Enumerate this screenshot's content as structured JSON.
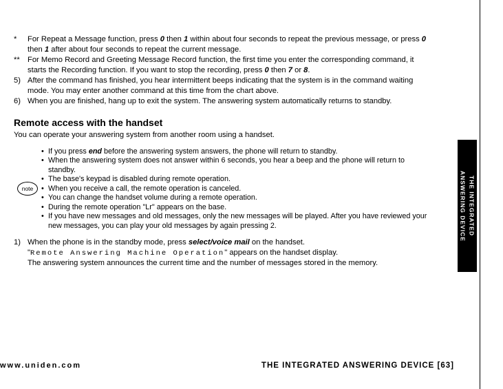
{
  "para_star_label": "*",
  "para_star": "For Repeat a Message function, press <b><i>0</i></b> then <b><i>1</i></b> within about four seconds to repeat the previous message, or press <b><i>0</i></b> then <b><i>1</i></b> after about four seconds to repeat the current message.",
  "para_dstar_label": "**",
  "para_dstar": "For Memo Record and Greeting Message Record function, the first time you enter the corresponding command, it starts the Recording function. If you want to stop the recording, press <b><i>0</i></b> then <b><i>7</i></b> or <b><i>8</i></b>.",
  "para_5_label": "5)",
  "para_5": "After the command has finished, you hear intermittent beeps indicating that the system is in the command waiting mode. You may enter another command at this time from the chart above.",
  "para_6_label": "6)",
  "para_6": "When you are finished, hang up to exit the system. The answering system automatically returns to standby.",
  "section_title": "Remote access with the handset",
  "section_lead": "You can operate your answering system from another room using a handset.",
  "note_label": "note",
  "notes": [
    "If you press <b><i>end</i></b> before the answering system answers, the phone will return to standby.",
    "When the answering system does not answer within 6 seconds, you hear a beep and the phone will return to standby.",
    "The base's keypad is disabled during remote operation.",
    "When you receive a call, the remote operation is canceled.",
    "You can change the handset volume during a remote operation.",
    "During the remote operation \"Lr\" appears on the base.",
    "If you have new messages and old messages, only the new messages will be played. After you have reviewed your new messages, you can play your old messages by again pressing 2."
  ],
  "step1_label": "1)",
  "step1_line1": "When the phone is in the standby mode, press <b><i>select/voice mail</i></b> on the handset.",
  "step1_mono": "Remote Answering Machine Operation",
  "step1_line2_tail": "\" appears on the handset display.",
  "step1_line3": "The answering system announces the current time and the number of messages stored in the memory.",
  "footer_url": "www.uniden.com",
  "footer_title": "THE INTEGRATED ANSWERING DEVICE [63]",
  "side_line1": "THE INTEGRATED",
  "side_line2": "ANSWERING DEVICE"
}
